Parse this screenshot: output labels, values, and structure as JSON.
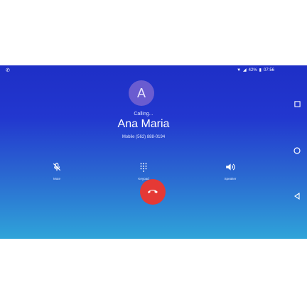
{
  "status": {
    "time": "07:56",
    "battery": "42%"
  },
  "call": {
    "avatar_letter": "A",
    "state": "Calling...",
    "contact_name": "Ana Maria",
    "number": "Mobile (562) 888-0194"
  },
  "actions": {
    "mute_label": "Mute",
    "keypad_label": "Keypad",
    "speaker_label": "Speaker"
  },
  "colors": {
    "background_top": "#1e2fc6",
    "background_bottom": "#2fa4d9",
    "end_call": "#e53935",
    "avatar": "#6a5cd0"
  },
  "icons": [
    "phone-icon",
    "wifi-icon",
    "signal-icon",
    "battery-icon",
    "mute-icon",
    "keypad-icon",
    "speaker-icon",
    "end-call-icon",
    "recent-apps-icon",
    "home-icon",
    "back-icon"
  ]
}
